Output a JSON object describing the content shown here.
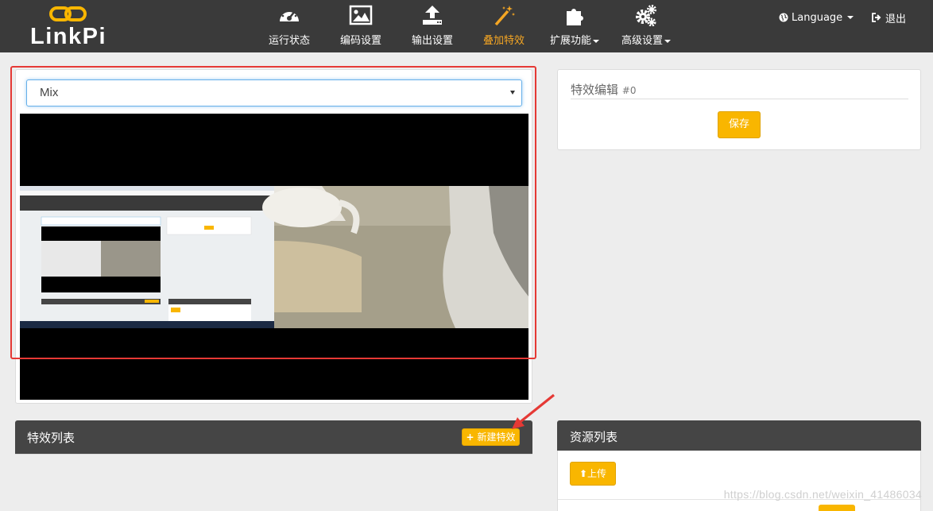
{
  "brand": {
    "name": "LinkPi"
  },
  "nav": {
    "items": [
      {
        "label": "运行状态",
        "icon": "dashboard-gauge-icon"
      },
      {
        "label": "编码设置",
        "icon": "image-icon"
      },
      {
        "label": "输出设置",
        "icon": "upload-icon"
      },
      {
        "label": "叠加特效",
        "icon": "magic-wand-icon",
        "active": true
      },
      {
        "label": "扩展功能",
        "icon": "puzzle-icon",
        "dropdown": true
      },
      {
        "label": "高级设置",
        "icon": "gears-icon",
        "dropdown": true
      }
    ],
    "language": "Language",
    "logout": "退出"
  },
  "mix_panel": {
    "select_value": "Mix"
  },
  "effect_edit": {
    "title": "特效编辑",
    "id_suffix": "#0",
    "save_label": "保存"
  },
  "effect_list": {
    "title": "特效列表",
    "new_label": "新建特效"
  },
  "resource_list": {
    "title": "资源列表",
    "upload_label": "上传"
  },
  "watermark": "https://blog.csdn.net/weixin_41486034",
  "colors": {
    "navbar": "#3a3a3a",
    "accent": "#f9b600",
    "active_nav": "#f5a623",
    "annotation_red": "#e53935"
  }
}
